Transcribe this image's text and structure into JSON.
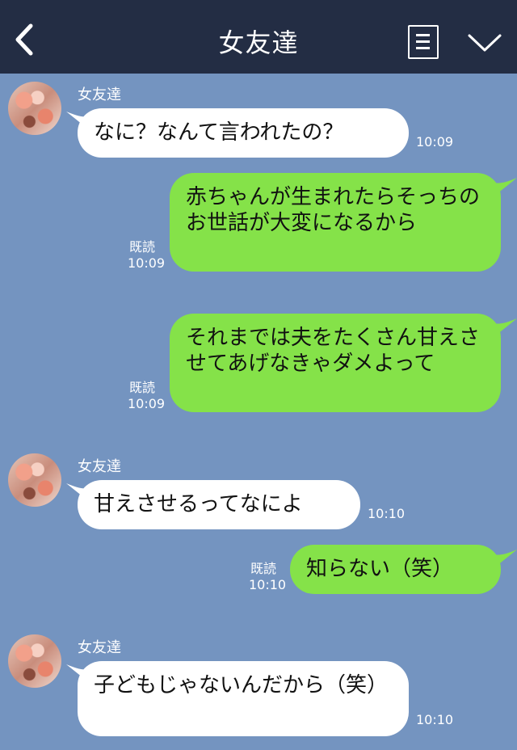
{
  "header": {
    "title": "女友達"
  },
  "icons": {
    "back": "chevron-left-icon",
    "menu": "list-icon",
    "collapse": "chevron-down-icon"
  },
  "colors": {
    "header_bg": "#232d44",
    "chat_bg": "#7494c0",
    "outgoing_bubble": "#85e249",
    "incoming_bubble": "#ffffff"
  },
  "messages": [
    {
      "side": "left",
      "sender": "女友達",
      "text": "なに？なんて言われたの？",
      "time": "10:09"
    },
    {
      "side": "right",
      "text": "赤ちゃんが生まれたらそっちのお世話が大変になるから",
      "read": "既読",
      "time": "10:09"
    },
    {
      "side": "right",
      "text": "それまでは夫をたくさん甘えさせてあげなきゃダメよって",
      "read": "既読",
      "time": "10:09"
    },
    {
      "side": "left",
      "sender": "女友達",
      "text": "甘えさせるってなによ",
      "time": "10:10"
    },
    {
      "side": "right",
      "text": "知らない（笑）",
      "read": "既読",
      "time": "10:10"
    },
    {
      "side": "left",
      "sender": "女友達",
      "text": "子どもじゃないんだから（笑）",
      "time": "10:10"
    }
  ]
}
